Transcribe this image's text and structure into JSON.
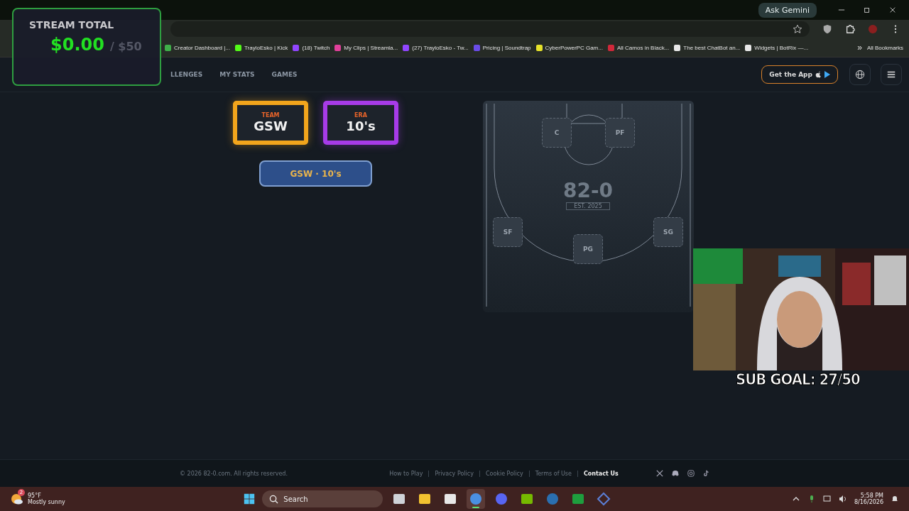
{
  "browser": {
    "gemini_button": "Ask Gemini",
    "bookmarks": [
      {
        "label": "Creator Dashboard |...",
        "color": "#3fae49"
      },
      {
        "label": "TrayloEsko | Kick",
        "color": "#53fc18"
      },
      {
        "label": "(18) Twitch",
        "color": "#9146ff"
      },
      {
        "label": "My Clips | Streamla...",
        "color": "#e0409a"
      },
      {
        "label": "(27) TrayloEsko - Tw...",
        "color": "#9146ff"
      },
      {
        "label": "Pricing | Soundtrap",
        "color": "#6a4ce8"
      },
      {
        "label": "CyberPowerPC Gam...",
        "color": "#e6e22a"
      },
      {
        "label": "All Camos in Black...",
        "color": "#d0283a"
      },
      {
        "label": "The best ChatBot an...",
        "color": "#e8e8e8"
      },
      {
        "label": "Widgets | BotRix —...",
        "color": "#e8e8e8"
      }
    ],
    "more_bookmarks": "»",
    "all_bookmarks": "All Bookmarks"
  },
  "site": {
    "nav": [
      {
        "label": "LLENGES",
        "selected": false
      },
      {
        "label": "MY STATS",
        "selected": false
      },
      {
        "label": "GAMES",
        "selected": false
      }
    ],
    "get_app_button": "Get the App",
    "picks": [
      {
        "kind": "team",
        "label": "TEAM",
        "value": "GSW"
      },
      {
        "kind": "era",
        "label": "ERA",
        "value": "10's"
      }
    ],
    "combo_button": "GSW · 10's",
    "court": {
      "logo": "82-0",
      "logo_sub": "EST. 2025",
      "positions": [
        "C",
        "PF",
        "SF",
        "SG",
        "PG"
      ]
    },
    "footer": {
      "copyright": "© 2026 82-0.com. All rights reserved.",
      "links": [
        {
          "label": "How to Play",
          "selected": false
        },
        {
          "label": "Privacy Policy",
          "selected": false
        },
        {
          "label": "Cookie Policy",
          "selected": false
        },
        {
          "label": "Terms of Use",
          "selected": false
        },
        {
          "label": "Contact Us",
          "selected": true
        }
      ]
    }
  },
  "overlay": {
    "title": "STREAM TOTAL",
    "amount": "$0.00",
    "goal": "/ $50",
    "sub_goal": "SUB GOAL: 27/50"
  },
  "taskbar": {
    "weather_badge": "2",
    "temperature": "95°F",
    "condition": "Mostly sunny",
    "search": {
      "placeholder": "Search"
    },
    "apps": [
      {
        "kind": "taskview",
        "selected": false
      },
      {
        "kind": "files",
        "selected": false
      },
      {
        "kind": "store",
        "selected": false
      },
      {
        "kind": "chrome",
        "selected": true
      },
      {
        "kind": "discord",
        "selected": false
      },
      {
        "kind": "nvidia",
        "selected": false
      },
      {
        "kind": "steam",
        "selected": false
      },
      {
        "kind": "xbox",
        "selected": false
      },
      {
        "kind": "diamond",
        "selected": false
      }
    ],
    "time": "5:58 PM",
    "date": "8/16/2026"
  }
}
